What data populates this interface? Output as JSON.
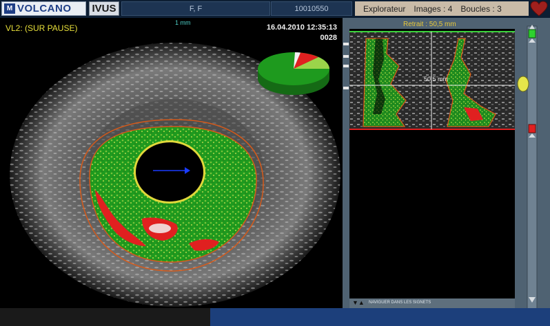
{
  "header": {
    "brand": "VOLCANO",
    "mode": "IVUS",
    "patient": "F, F",
    "patient_id": "10010550",
    "menu": {
      "explorer": "Explorateur",
      "images": "Images : 4",
      "loops": "Boucles : 3"
    }
  },
  "viewer": {
    "status": "VL2:  (SUR PAUSE)",
    "scale": "1 mm",
    "datetime": "16.04.2010 12:35:13",
    "frame": "0028"
  },
  "longitudinal": {
    "retrait": "Retrait : 50,5 mm",
    "position": "50,5 mm"
  },
  "nav": {
    "label": "NAVIGUER DANS LES SIGNETS"
  },
  "colors": {
    "fibrous": "#1e9a1e",
    "fibrofatty": "#9bd44a",
    "necrotic": "#e02020",
    "calcium": "#f2f2f2"
  }
}
